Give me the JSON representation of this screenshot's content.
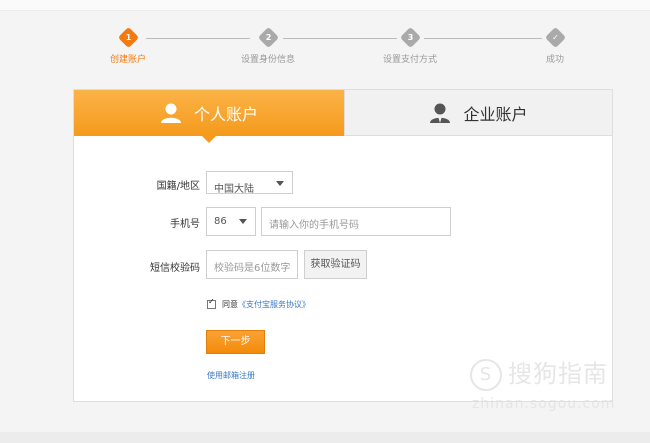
{
  "steps": [
    {
      "num": "1",
      "label": "创建账户",
      "active": true
    },
    {
      "num": "2",
      "label": "设置身份信息",
      "active": false
    },
    {
      "num": "3",
      "label": "设置支付方式",
      "active": false
    },
    {
      "num": "✓",
      "label": "成功",
      "active": false
    }
  ],
  "tabs": {
    "personal": "个人账户",
    "business": "企业账户"
  },
  "form": {
    "region_label": "国籍/地区",
    "region_value": "中国大陆",
    "phone_label": "手机号",
    "country_code": "86",
    "phone_placeholder": "请输入你的手机号码",
    "sms_label": "短信校验码",
    "sms_placeholder": "校验码是6位数字",
    "get_code_label": "获取验证码",
    "agree_text": "同意",
    "agree_link": "《支付宝服务协议》",
    "next_label": "下一步",
    "email_link": "使用邮箱注册"
  },
  "watermark": {
    "text": "搜狗指南",
    "url": "zhinan.sogou.com"
  },
  "colors": {
    "accent": "#f5790e",
    "tab_orange": "#f59a1c",
    "link": "#3a77c2"
  }
}
